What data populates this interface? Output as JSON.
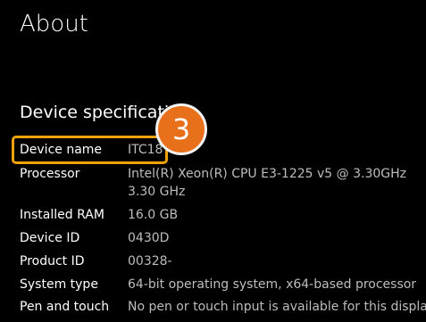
{
  "page": {
    "title": "About"
  },
  "device_specifications": {
    "title": "Device specificatio",
    "rows": [
      {
        "label": "Device name",
        "value": "ITC18"
      },
      {
        "label": "Processor",
        "value": "Intel(R) Xeon(R) CPU E3-1225 v5 @ 3.30GHz",
        "value2": "3.30 GHz"
      },
      {
        "label": "Installed RAM",
        "value": "16.0 GB"
      },
      {
        "label": "Device ID",
        "value": "0430D"
      },
      {
        "label": "Product ID",
        "value": "00328-"
      },
      {
        "label": "System type",
        "value": "64-bit operating system, x64-based processor"
      },
      {
        "label": "Pen and touch",
        "value": "No pen or touch input is available for this display"
      }
    ]
  },
  "annotation": {
    "step_number": "3",
    "badge_color": "#e8701a",
    "highlight_color": "#f0a30a"
  }
}
